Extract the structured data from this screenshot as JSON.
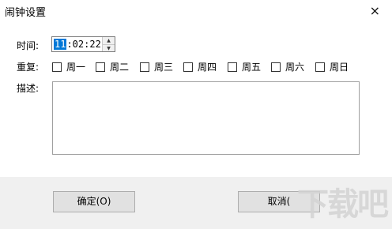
{
  "window": {
    "title": "闹钟设置",
    "close_glyph": "×"
  },
  "fields": {
    "time_label": "时间:",
    "time": {
      "hour": "11",
      "rest": ":02:22"
    },
    "repeat_label": "重复:",
    "days": [
      "周一",
      "周二",
      "周三",
      "周四",
      "周五",
      "周六",
      "周日"
    ],
    "desc_label": "描述:",
    "desc_value": ""
  },
  "buttons": {
    "ok": "确定(O)",
    "cancel": "取消("
  },
  "watermark": "下载吧",
  "icons": {
    "spin_up": "▲",
    "spin_down": "▼"
  }
}
